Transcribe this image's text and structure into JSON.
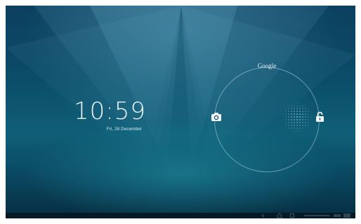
{
  "lockscreen": {
    "time": "10:59",
    "date": "Fri, 28 December",
    "target_top_label": "Google"
  },
  "icons": {
    "left_target": "camera-icon",
    "right_target": "unlock-icon",
    "center_handle": "dot-grid-handle"
  },
  "colors": {
    "background_dark": "#0c3f5e",
    "background_glow": "#2396aa",
    "text": "#eaf4f8",
    "navbar": "#061a24"
  }
}
